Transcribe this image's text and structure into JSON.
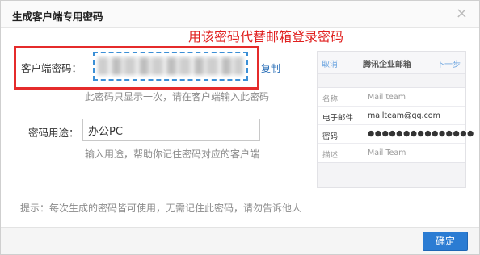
{
  "dialog": {
    "title": "生成客户端专用密码",
    "close_glyph": "×"
  },
  "annotation": "用该密码代替邮箱登录密码",
  "password_field": {
    "label": "客户端密码：",
    "copy_label": "复制",
    "hint": "此密码只显示一次，请在客户端输入此密码"
  },
  "purpose_field": {
    "label": "密码用途：",
    "value": "办公PC",
    "hint": "输入用途，帮助你记住密码对应的客户端"
  },
  "tip": "提示：每次生成的密码皆可使用，无需记住此密码，请勿告诉他人",
  "footer": {
    "ok_label": "确定"
  },
  "phone": {
    "cancel": "取消",
    "title": "腾讯企业邮箱",
    "next": "下一步",
    "rows": [
      {
        "key": "名称",
        "value": "Mail team"
      },
      {
        "key": "电子邮件",
        "value": "mailteam@qq.com"
      },
      {
        "key": "密码",
        "value": "●●●●●●●●●●●●●●●"
      },
      {
        "key": "描述",
        "value": "Mail Team"
      }
    ]
  },
  "colors": {
    "accent": "#2b7cd3",
    "annotation_red": "#e0201f",
    "link": "#2a6fb8"
  }
}
